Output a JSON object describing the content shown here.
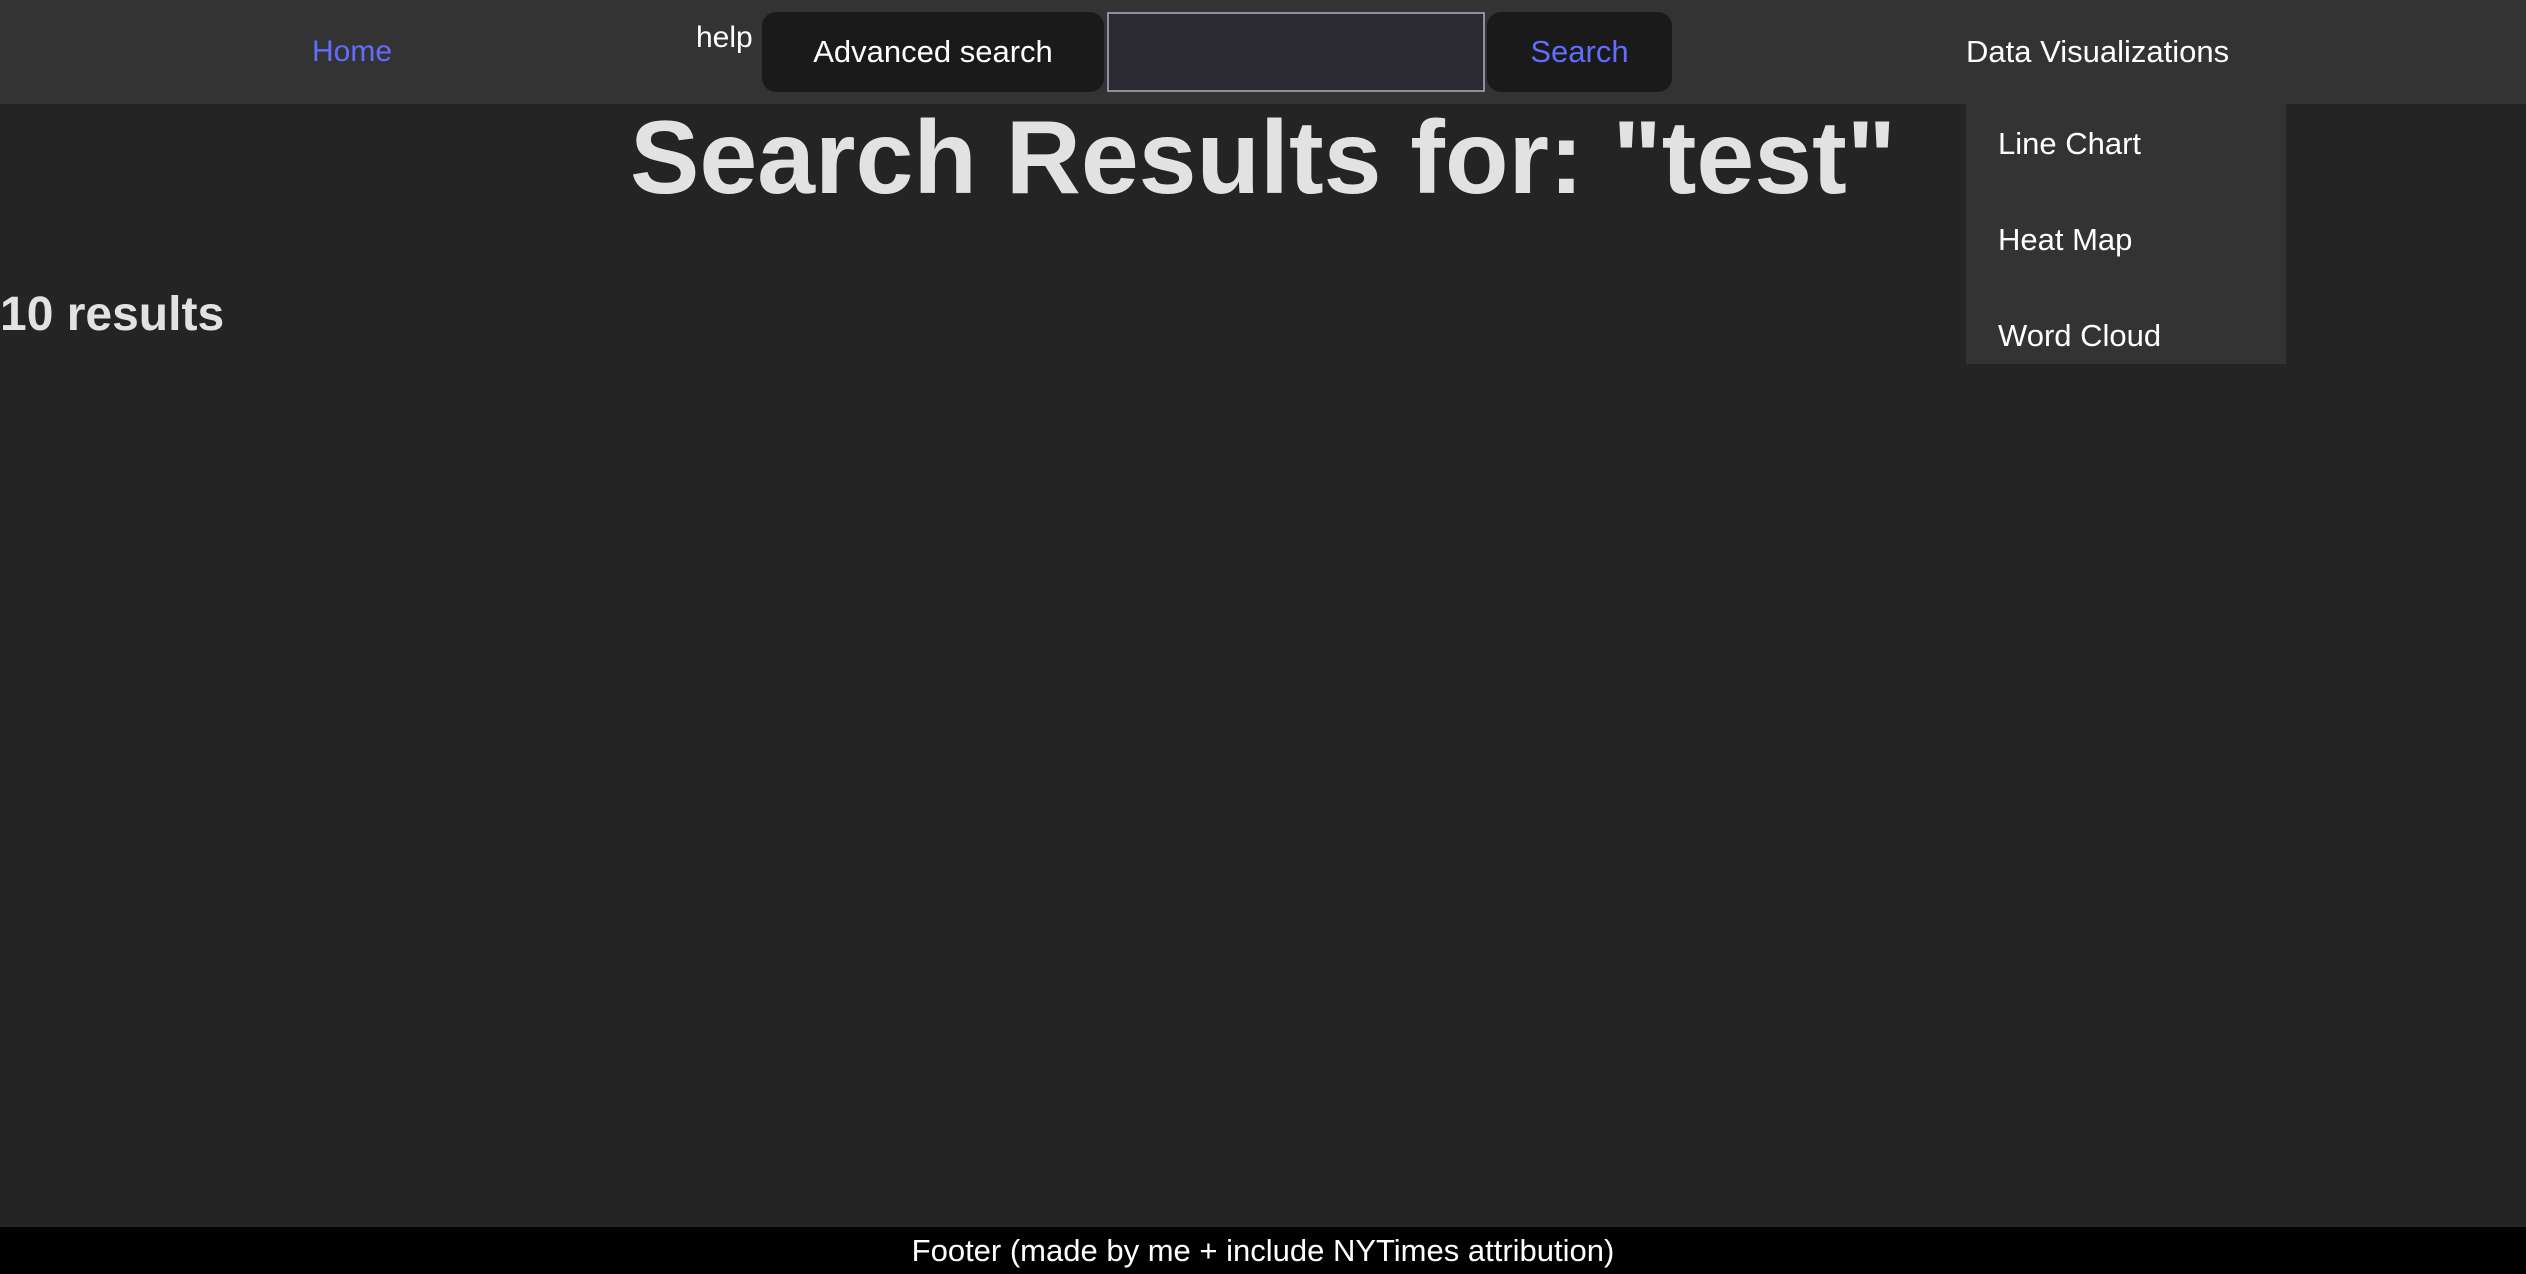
{
  "nav": {
    "home_label": "Home",
    "help_label": "help",
    "advanced_search_label": "Advanced search",
    "search_value": "",
    "search_placeholder": "",
    "search_button_label": "Search",
    "data_viz_label": "Data Visualizations",
    "data_viz_items": [
      {
        "label": "Line Chart"
      },
      {
        "label": "Heat Map"
      },
      {
        "label": "Word Cloud"
      }
    ]
  },
  "main": {
    "title": "Search Results for: \"test\"",
    "results_count": "10 results"
  },
  "footer": {
    "text": "Footer (made by me + include NYTimes attribution)"
  },
  "colors": {
    "background": "#242424",
    "navbar": "#333333",
    "accent_link": "#646cff",
    "button_bg": "#1a1a1a",
    "footer_bg": "#000000"
  }
}
